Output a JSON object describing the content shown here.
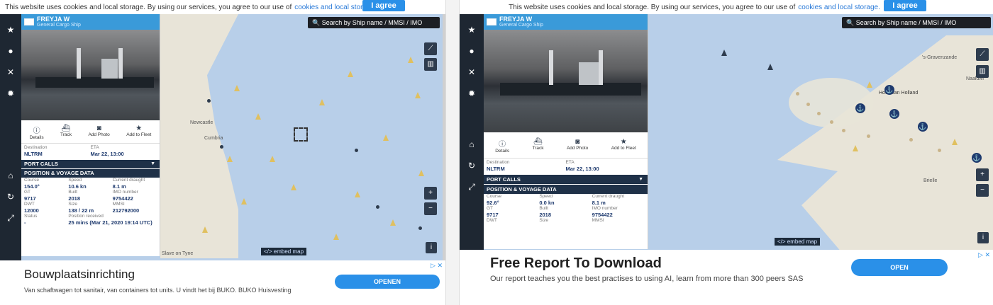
{
  "cookie": {
    "text": "This website uses cookies and local storage. By using our services, you agree to our use of",
    "link": "cookies and local storage.",
    "agree": "I agree"
  },
  "vessel": {
    "name": "FREYJA W",
    "type": "General Cargo Ship"
  },
  "search": {
    "placeholder": "Search by Ship name / MMSI / IMO"
  },
  "actions": {
    "details": "Details",
    "track": "Track",
    "add_photo": "Add Photo",
    "add_fleet": "Add to Fleet"
  },
  "labels": {
    "destination": "Destination",
    "eta": "ETA",
    "course": "Course",
    "speed": "Speed",
    "current_draught": "Current draught",
    "gt": "GT",
    "built": "Built",
    "imo_number": "IMO number",
    "dwt": "DWT",
    "size": "Size",
    "mmsi": "MMSI",
    "status": "Status",
    "position_received": "Position received"
  },
  "sections": {
    "port_calls": "PORT CALLS",
    "position_voyage": "POSITION & VOYAGE DATA"
  },
  "embed": "</> embed map",
  "left": {
    "destination": "NLTRM",
    "eta": "Mar 22, 13:00",
    "course": "154.0°",
    "speed": "10.6 kn",
    "draught": "8.1 m",
    "gt": "9717",
    "built": "2018",
    "imo": "9754422",
    "dwt": "12000",
    "size": "138 / 22 m",
    "mmsi": "212792000",
    "status": "-",
    "position_received": "25 mins (Mar 21, 2020 19:14 UTC)",
    "map_labels": {
      "newcastle": "Newcastle",
      "cumbria": "Cumbria",
      "slave": "Slave on Tyne"
    },
    "ad": {
      "title": "Bouwplaatsinrichting",
      "text": "Van schaftwagen tot sanitair, van containers tot units. U vindt het bij BUKO. BUKO Huisvesting",
      "button": "OPENEN"
    }
  },
  "right": {
    "destination": "NLTRM",
    "eta": "Mar 22, 13:00",
    "course": "92.6°",
    "speed": "0.0 kn",
    "draught": "8.1 m",
    "gt": "9717",
    "built": "2018",
    "imo": "9754422",
    "map_labels": {
      "gravenzande": "'s-Gravenzande",
      "naaldwijk": "Naaldwi",
      "hook": "Hoek van Holland",
      "brielle": "Brielle"
    },
    "ad": {
      "title": "Free Report To Download",
      "text": "Our report teaches you the best practises to using AI, learn from more than 300 peers SAS",
      "button": "OPEN"
    }
  },
  "icons": {
    "star": "★",
    "pin": "●",
    "satellite": "✕",
    "gear": "✹",
    "antenna": "⌂",
    "refresh": "↻",
    "expand": "⤢",
    "plus": "+",
    "minus": "−",
    "info": "i",
    "ruler": "⟋",
    "layers": "▥",
    "ad_close": "▷ ✕"
  },
  "colors": {
    "header_blue": "#3a9ad9",
    "nav_dark": "#1e2732",
    "sea": "#b8cfe9",
    "land": "#e8e4d8",
    "button_blue": "#2a90e8"
  }
}
